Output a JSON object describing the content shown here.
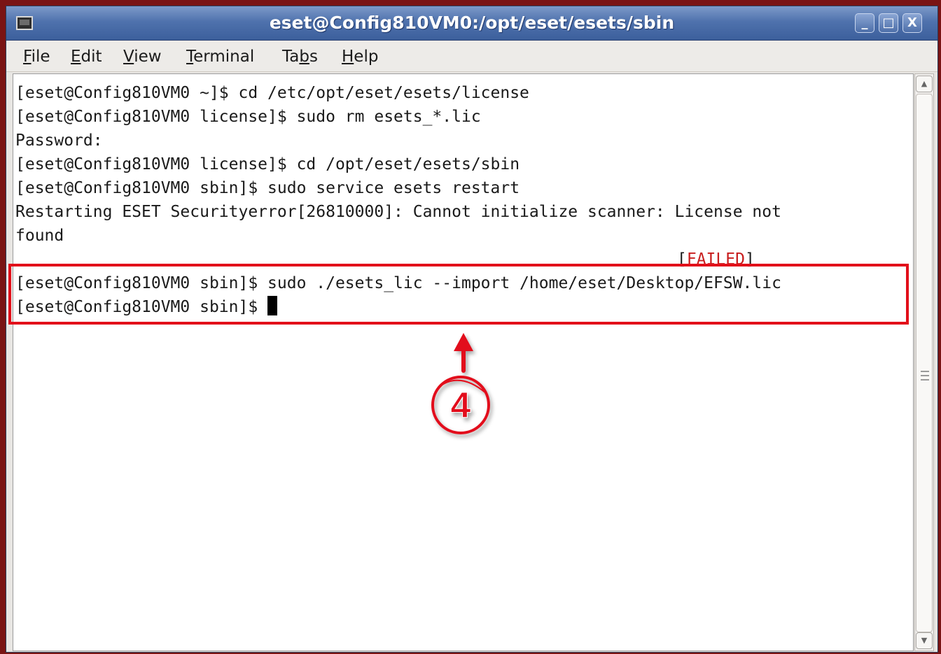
{
  "window": {
    "title": "eset@Config810VM0:/opt/eset/esets/sbin",
    "buttons": {
      "minimize": "_",
      "maximize": "□",
      "close": "X"
    }
  },
  "menu": [
    {
      "label": "File",
      "mnemonic": "F",
      "rest": "ile"
    },
    {
      "label": "Edit",
      "mnemonic": "E",
      "rest": "dit"
    },
    {
      "label": "View",
      "mnemonic": "V",
      "rest": "iew"
    },
    {
      "label": "Terminal",
      "mnemonic": "T",
      "rest": "erminal"
    },
    {
      "label": "Tabs",
      "pre": "Ta",
      "mnemonic": "b",
      "rest": "s"
    },
    {
      "label": "Help",
      "mnemonic": "H",
      "rest": "elp"
    }
  ],
  "terminal": {
    "lines": [
      "[eset@Config810VM0 ~]$ cd /etc/opt/eset/esets/license",
      "[eset@Config810VM0 license]$ sudo rm esets_*.lic",
      "Password:",
      "[eset@Config810VM0 license]$ cd /opt/eset/esets/sbin",
      "[eset@Config810VM0 sbin]$ sudo service esets restart",
      "Restarting ESET Securityerror[26810000]: Cannot initialize scanner: License not",
      "found"
    ],
    "failed": {
      "open": "[",
      "word": "FAILED",
      "close": "]"
    },
    "highlighted_lines": [
      "[eset@Config810VM0 sbin]$ sudo ./esets_lic --import /home/eset/Desktop/EFSW.lic",
      "[eset@Config810VM0 sbin]$ "
    ]
  },
  "annotation": {
    "step_number": "4",
    "color": "#e20f1a"
  },
  "colors": {
    "titlebar": "#4f72ad",
    "failed": "#c81d1d",
    "highlight": "#e20f1a"
  }
}
